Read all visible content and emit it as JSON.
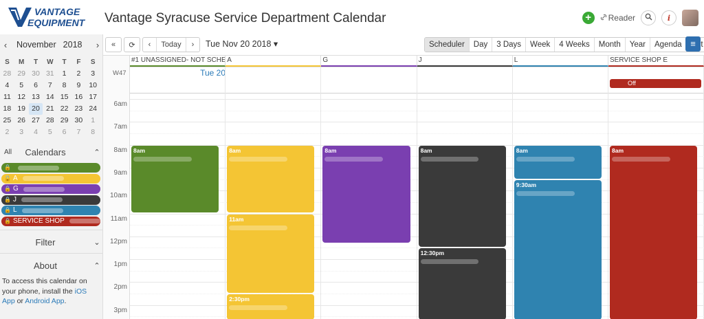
{
  "header": {
    "logo_line1": "VANTAGE",
    "logo_line2": "EQUIPMENT",
    "title": "Vantage Syracuse Service Department Calendar",
    "add_label": "+",
    "reader_label": "Reader",
    "search_icon": "search-icon",
    "info_label": "i"
  },
  "mini_calendar": {
    "month": "November",
    "year": "2018",
    "prev": "‹",
    "next": "›",
    "weekdays": [
      "S",
      "M",
      "T",
      "W",
      "T",
      "F",
      "S"
    ],
    "weeks": [
      [
        "28",
        "29",
        "30",
        "31",
        "1",
        "2",
        "3"
      ],
      [
        "4",
        "5",
        "6",
        "7",
        "8",
        "9",
        "10"
      ],
      [
        "11",
        "12",
        "13",
        "14",
        "15",
        "16",
        "17"
      ],
      [
        "18",
        "19",
        "20",
        "21",
        "22",
        "23",
        "24"
      ],
      [
        "25",
        "26",
        "27",
        "28",
        "29",
        "30",
        "1"
      ],
      [
        "2",
        "3",
        "4",
        "5",
        "6",
        "7",
        "8"
      ]
    ],
    "today": "20"
  },
  "sidebar": {
    "all_label": "All",
    "calendars_title": "Calendars",
    "calendars": [
      {
        "label": "",
        "color": "#5a8a2a"
      },
      {
        "label": "A",
        "color": "#f4c534"
      },
      {
        "label": "G",
        "color": "#7a3fb0"
      },
      {
        "label": "J",
        "color": "#3a3a3a"
      },
      {
        "label": "L",
        "color": "#2f83b0"
      },
      {
        "label": "SERVICE SHOP",
        "color": "#b02a1f"
      }
    ],
    "filter_title": "Filter",
    "about_title": "About",
    "about_text_1": "To access this calendar on your phone, install the ",
    "about_link_ios": "iOS App",
    "about_text_2": " or ",
    "about_link_android": "Android App",
    "about_text_3": "."
  },
  "toolbar": {
    "back_label": "«",
    "refresh_label": "⟳",
    "prev_label": "‹",
    "today_label": "Today",
    "next_label": "›",
    "date_label": "Tue Nov 20 2018 ▾",
    "views": [
      "Scheduler",
      "Day",
      "3 Days",
      "Week",
      "4 Weeks",
      "Month",
      "Year",
      "Agenda",
      "List"
    ],
    "active_view": "Scheduler",
    "menu_label": "≡"
  },
  "grid": {
    "week": "W47",
    "day_label": "Tue 20",
    "columns": [
      {
        "name": "#1 UNASSIGNED- NOT SCHE...",
        "color": "#5a8a2a"
      },
      {
        "name": "A",
        "color": "#f4c534"
      },
      {
        "name": "G",
        "color": "#7a3fb0"
      },
      {
        "name": "J",
        "color": "#3a3a3a"
      },
      {
        "name": "L",
        "color": "#2f83b0"
      },
      {
        "name": "SERVICE SHOP E",
        "color": "#b02a1f"
      }
    ],
    "hours": [
      "6am",
      "7am",
      "8am",
      "9am",
      "10am",
      "11am",
      "12pm",
      "1pm",
      "2pm",
      "3pm"
    ],
    "allday_event": {
      "label": "Off",
      "color": "#b02a1f"
    },
    "events": [
      {
        "col": 0,
        "time": "8am",
        "start": 8.0,
        "end": 11.0,
        "color": "#5a8a2a"
      },
      {
        "col": 1,
        "time": "8am",
        "start": 8.0,
        "end": 11.0,
        "color": "#f4c534"
      },
      {
        "col": 1,
        "time": "11am",
        "start": 11.0,
        "end": 14.5,
        "color": "#f4c534"
      },
      {
        "col": 1,
        "time": "2:30pm",
        "start": 14.5,
        "end": 16.0,
        "color": "#f4c534"
      },
      {
        "col": 2,
        "time": "8am",
        "start": 8.0,
        "end": 12.3,
        "color": "#7a3fb0"
      },
      {
        "col": 3,
        "time": "8am",
        "start": 8.0,
        "end": 12.5,
        "color": "#3a3a3a"
      },
      {
        "col": 3,
        "time": "12:30pm",
        "start": 12.5,
        "end": 16.0,
        "color": "#3a3a3a"
      },
      {
        "col": 4,
        "time": "8am",
        "start": 8.0,
        "end": 9.5,
        "color": "#2f83b0"
      },
      {
        "col": 4,
        "time": "9:30am",
        "start": 9.5,
        "end": 16.0,
        "color": "#2f83b0"
      },
      {
        "col": 5,
        "time": "8am",
        "start": 8.0,
        "end": 16.0,
        "color": "#b02a1f"
      }
    ]
  }
}
